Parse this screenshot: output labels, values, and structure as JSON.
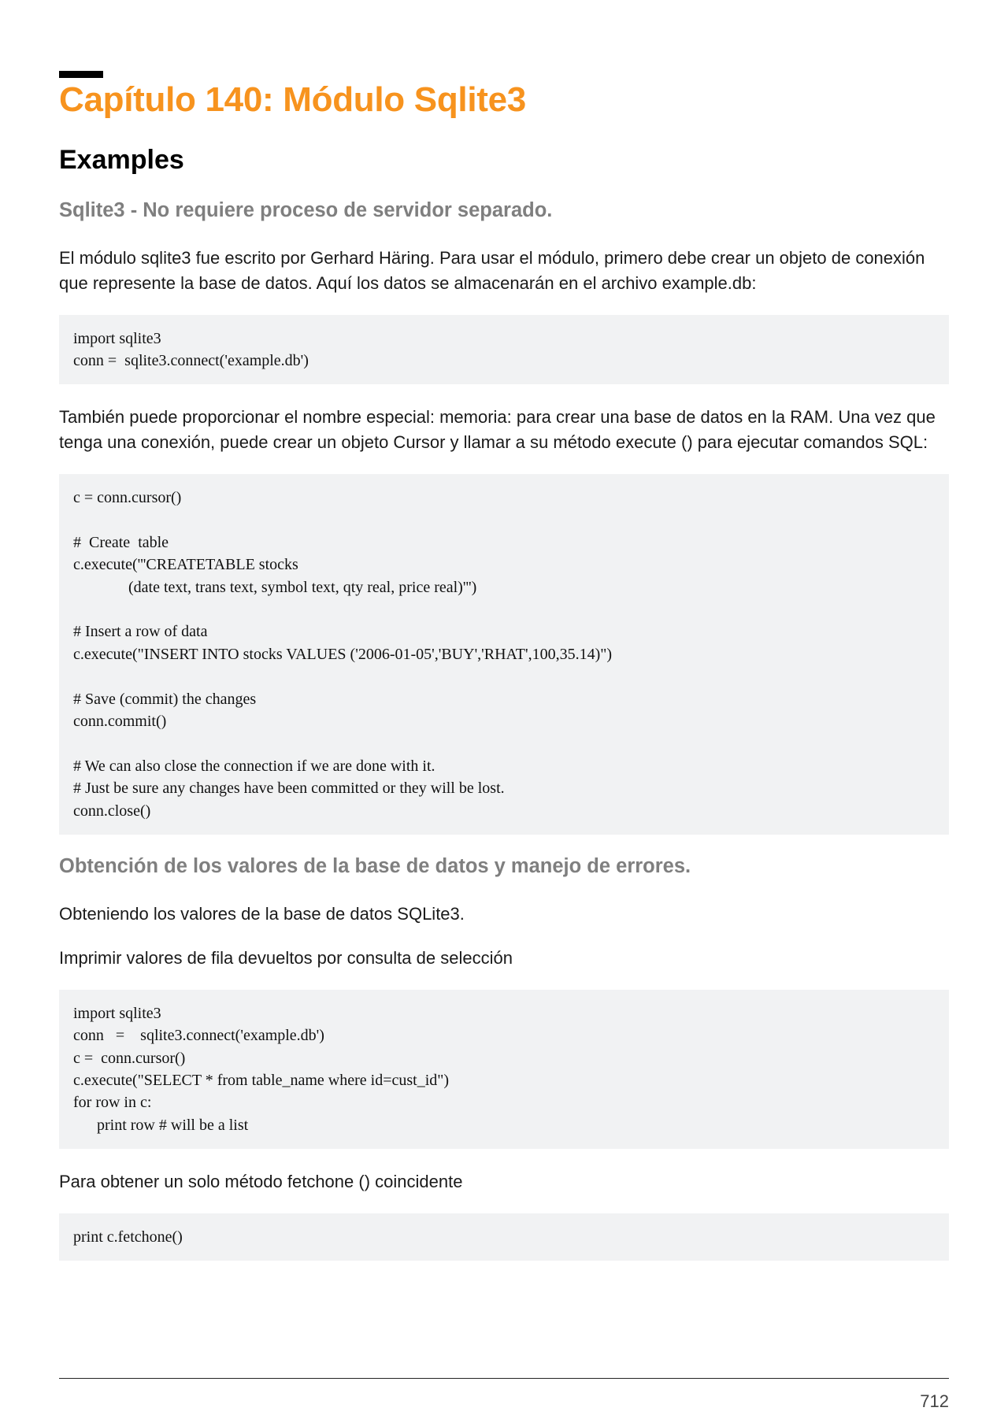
{
  "chapter": {
    "title": "Capítulo 140: Módulo Sqlite3"
  },
  "sections": {
    "examples": "Examples",
    "sub1": "Sqlite3 - No requiere proceso de servidor separado.",
    "p1": "El módulo sqlite3 fue escrito por Gerhard Häring. Para usar el módulo, primero debe crear un objeto de conexión que represente la base de datos. Aquí los datos se almacenarán en el archivo example.db:",
    "code1": "import sqlite3\nconn =  sqlite3.connect('example.db')",
    "p2": "También puede proporcionar el nombre especial: memoria: para crear una base de datos en la RAM. Una vez que tenga una conexión, puede crear un objeto Cursor y llamar a su método execute () para ejecutar comandos SQL:",
    "code2": "c = conn.cursor()\n\n#  Create  table\nc.execute('''CREATETABLE stocks\n              (date text, trans text, symbol text, qty real, price real)''')\n\n# Insert a row of data\nc.execute(\"INSERT INTO stocks VALUES ('2006-01-05','BUY','RHAT',100,35.14)\")\n\n# Save (commit) the changes\nconn.commit()\n\n# We can also close the connection if we are done with it.\n# Just be sure any changes have been committed or they will be lost.\nconn.close()",
    "sub2": "Obtención de los valores de la base de datos y manejo de errores.",
    "p3": "Obteniendo los valores de la base de datos SQLite3.",
    "p4": "Imprimir valores de fila devueltos por consulta de selección",
    "code3": "import sqlite3\nconn   =    sqlite3.connect('example.db')\nc =  conn.cursor()\nc.execute(\"SELECT * from table_name where id=cust_id\")\nfor row in c:\n      print row # will be a list",
    "p5": "Para obtener un solo método fetchone () coincidente",
    "code4": "print c.fetchone()"
  },
  "page_number": "712"
}
